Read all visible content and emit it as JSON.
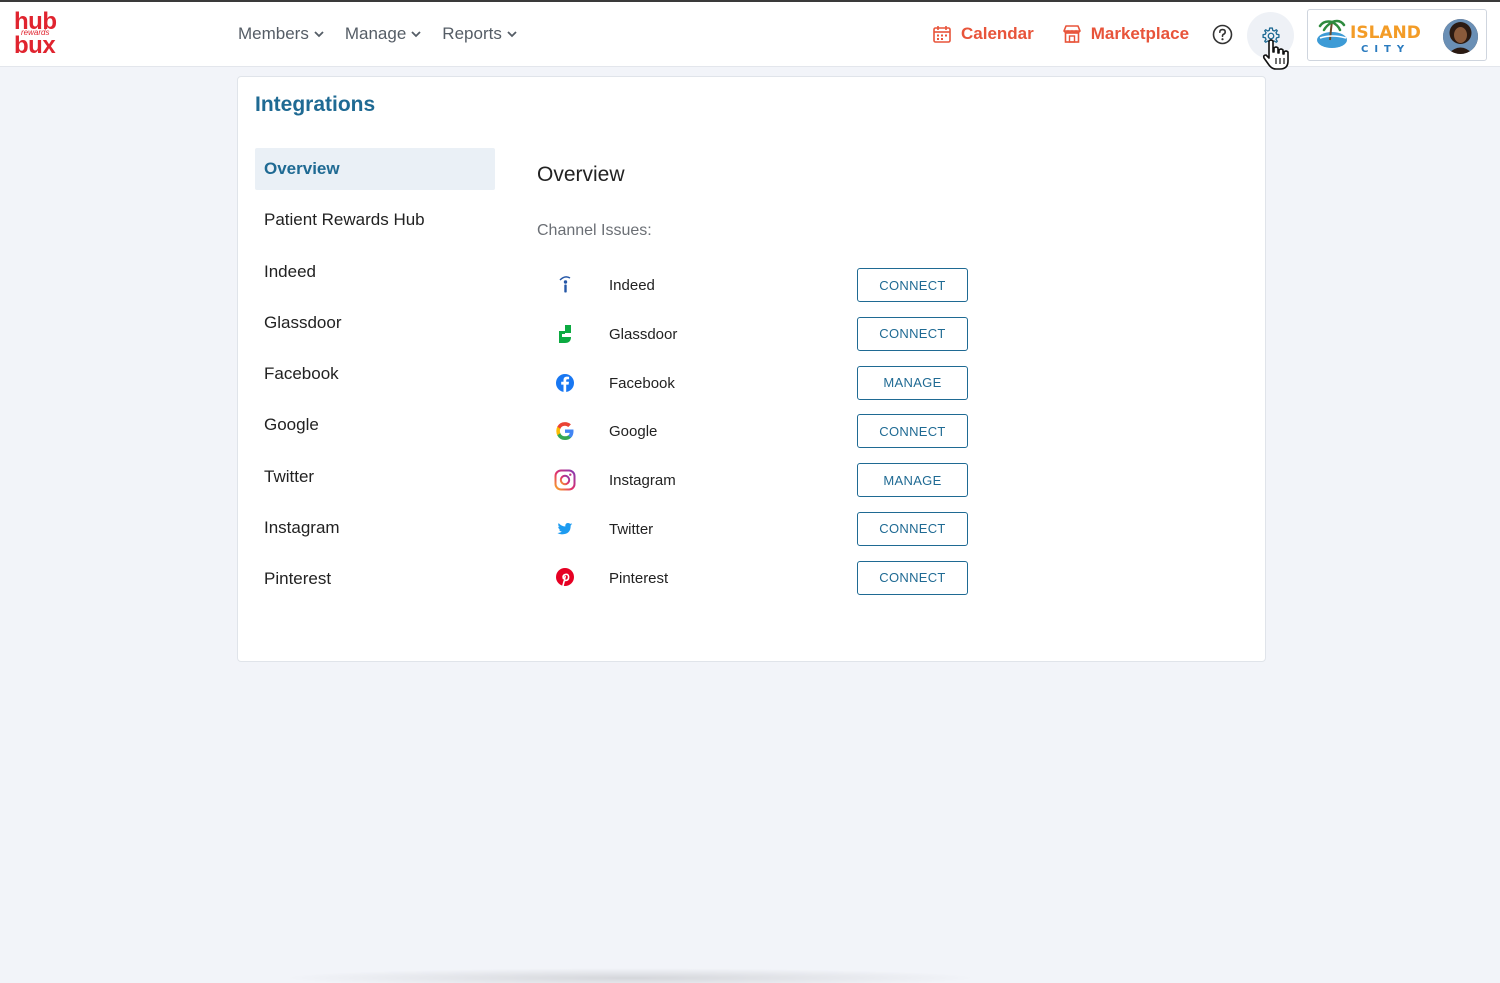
{
  "logo": {
    "line1": "hub",
    "line2": "rewards",
    "line3": "bux"
  },
  "nav": [
    {
      "label": "Members"
    },
    {
      "label": "Manage"
    },
    {
      "label": "Reports"
    }
  ],
  "links": {
    "calendar": "Calendar",
    "marketplace": "Marketplace"
  },
  "account": {
    "brand_line1": "ISLAND",
    "brand_line2": "CITY"
  },
  "page": {
    "title": "Integrations",
    "sidebar": [
      "Overview",
      "Patient Rewards Hub",
      "Indeed",
      "Glassdoor",
      "Facebook",
      "Google",
      "Twitter",
      "Instagram",
      "Pinterest"
    ],
    "section_title": "Overview",
    "section_subtitle": "Channel Issues:",
    "channels": [
      {
        "name": "Indeed",
        "icon": "indeed-icon",
        "action": "CONNECT"
      },
      {
        "name": "Glassdoor",
        "icon": "glassdoor-icon",
        "action": "CONNECT"
      },
      {
        "name": "Facebook",
        "icon": "facebook-icon",
        "action": "MANAGE"
      },
      {
        "name": "Google",
        "icon": "google-icon",
        "action": "CONNECT"
      },
      {
        "name": "Instagram",
        "icon": "instagram-icon",
        "action": "MANAGE"
      },
      {
        "name": "Twitter",
        "icon": "twitter-icon",
        "action": "CONNECT"
      },
      {
        "name": "Pinterest",
        "icon": "pinterest-icon",
        "action": "CONNECT"
      }
    ]
  },
  "colors": {
    "accent": "#1f6a93",
    "brand_red": "#e0242f",
    "link_orange": "#e8543a",
    "background": "#f2f4f9"
  }
}
